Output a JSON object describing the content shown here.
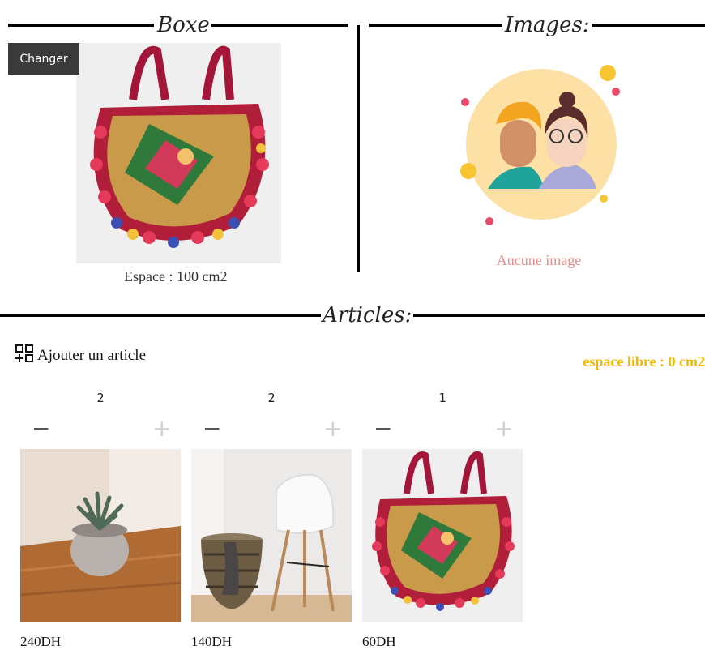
{
  "box": {
    "title": "Boxe",
    "change_label": "Changer",
    "space_label": "Espace : 100 cm2"
  },
  "images": {
    "title": "Images:",
    "empty_label": "Aucune image"
  },
  "articles": {
    "title": "Articles:",
    "add_label": "Ajouter un article",
    "free_space_label": "espace libre : 0 cm2",
    "items": [
      {
        "quantity": "2",
        "price": "240DH",
        "image": "succulent-plant-photo"
      },
      {
        "quantity": "2",
        "price": "140DH",
        "image": "chair-and-basket-photo"
      },
      {
        "quantity": "1",
        "price": "60DH",
        "image": "embroidered-bag-photo"
      }
    ]
  },
  "colors": {
    "empty_text": "#f08a8a",
    "free_space": "#f5b800",
    "button_bg": "#3a3a3a"
  }
}
